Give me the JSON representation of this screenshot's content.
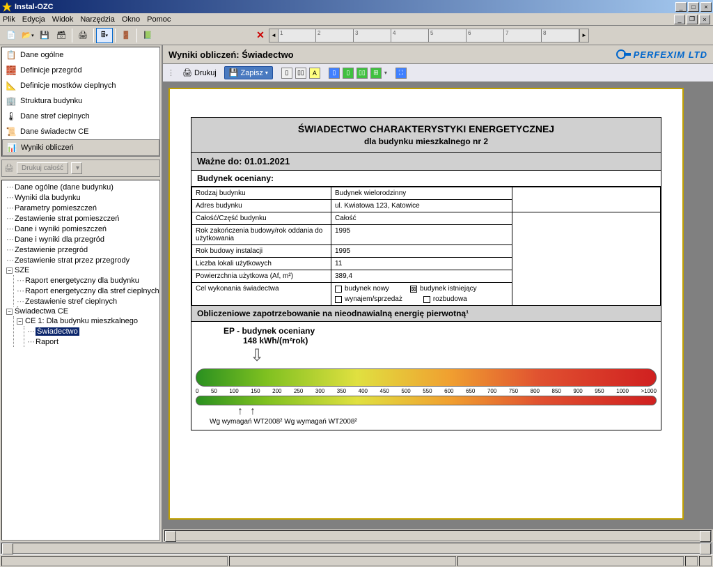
{
  "window": {
    "title": "Instal-OZC"
  },
  "menu": [
    "Plik",
    "Edycja",
    "Widok",
    "Narzędzia",
    "Okno",
    "Pomoc"
  ],
  "nav": [
    {
      "label": "Dane ogólne",
      "icon": "📋"
    },
    {
      "label": "Definicje przegród",
      "icon": "🧱"
    },
    {
      "label": "Definicje mostków cieplnych",
      "icon": "📐"
    },
    {
      "label": "Struktura budynku",
      "icon": "🏢"
    },
    {
      "label": "Dane stref cieplnych",
      "icon": "🌡"
    },
    {
      "label": "Dane świadectw CE",
      "icon": "📜"
    },
    {
      "label": "Wyniki obliczeń",
      "icon": "📊",
      "active": true
    }
  ],
  "print_all": "Drukuj całość",
  "tree": {
    "items": [
      "Dane ogólne (dane budynku)",
      "Wyniki dla budynku",
      "Parametry pomieszczeń",
      "Zestawienie strat pomieszczeń",
      "Dane i wyniki pomieszczeń",
      "Dane i wyniki dla przegród",
      "Zestawienie przegród",
      "Zestawienie strat przez przegrody"
    ],
    "sze": {
      "label": "SZE",
      "children": [
        "Raport energetyczny dla budynku",
        "Raport energetyczny dla stref cieplnych",
        "Zestawienie stref cieplnych"
      ]
    },
    "ce": {
      "label": "Świadectwa CE",
      "child_label": "CE 1: Dla budynku mieszkalnego",
      "grandchildren": [
        "Świadectwo",
        "Raport"
      ],
      "selected": "Świadectwo"
    }
  },
  "panel": {
    "title": "Wyniki obliczeń: Świadectwo",
    "brand": "PERFEXIM LTD"
  },
  "doc_toolbar": {
    "print": "Drukuj",
    "save": "Zapisz"
  },
  "cert": {
    "title": "ŚWIADECTWO CHARAKTERYSTYKI ENERGETYCZNEJ",
    "subtitle": "dla budynku mieszkalnego nr 2",
    "valid_label": "Ważne do:",
    "valid_date": "01.01.2021",
    "section1": "Budynek oceniany:",
    "rows": [
      {
        "k": "Rodzaj budynku",
        "v": "Budynek wielorodzinny"
      },
      {
        "k": "Adres budynku",
        "v": "ul. Kwiatowa 123, Katowice"
      },
      {
        "k": "Całość/Część budynku",
        "v": "Całość"
      },
      {
        "k": "Rok zakończenia budowy/rok oddania do użytkowania",
        "v": "1995"
      },
      {
        "k": "Rok budowy instalacji",
        "v": "1995"
      },
      {
        "k": "Liczba lokali użytkowych",
        "v": "11"
      },
      {
        "k": "Powierzchnia użytkowa (Af, m²)",
        "v": "389,4"
      }
    ],
    "purpose_label": "Cel wykonania świadectwa",
    "checkboxes": [
      {
        "label": "budynek nowy",
        "checked": false
      },
      {
        "label": "budynek istniejący",
        "checked": true
      },
      {
        "label": "wynajem/sprzedaż",
        "checked": false
      },
      {
        "label": "rozbudowa",
        "checked": false
      }
    ],
    "section2": "Obliczeniowe zapotrzebowanie na nieodnawialną energię pierwotną¹",
    "ep_label": "EP - budynek oceniany",
    "ep_value": "148 kWh/(m²rok)",
    "scale": [
      "0",
      "50",
      "100",
      "150",
      "200",
      "250",
      "300",
      "350",
      "400",
      "450",
      "500",
      "550",
      "600",
      "650",
      "700",
      "750",
      "800",
      "850",
      "900",
      "950",
      "1000",
      ">1000"
    ],
    "wt_text": "Wg wymagań WT2008²  Wg wymagań WT2008²"
  }
}
